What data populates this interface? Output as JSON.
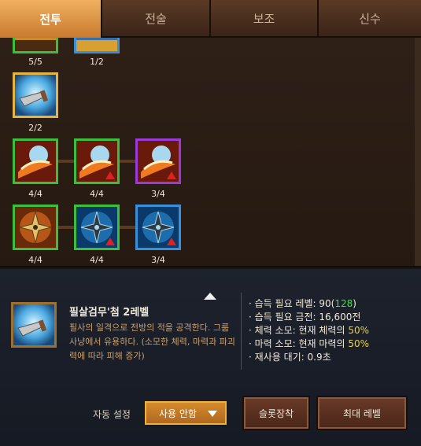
{
  "tabs": [
    {
      "label": "전투",
      "active": true
    },
    {
      "label": "전술",
      "active": false
    },
    {
      "label": "보조",
      "active": false
    },
    {
      "label": "신수",
      "active": false
    }
  ],
  "tree": {
    "slots": [
      {
        "name": "skill-top-left",
        "level": "5/5",
        "border": "green",
        "icon": "sword-icon"
      },
      {
        "name": "skill-top-mid",
        "level": "1/2",
        "border": "blue",
        "icon": "sword-icon"
      },
      {
        "name": "skill-selected",
        "level": "2/2",
        "border": "gold",
        "icon": "greatsword-icon"
      },
      {
        "name": "skill-fire-slash-1",
        "level": "4/4",
        "border": "green",
        "icon": "fire-slash-icon"
      },
      {
        "name": "skill-fire-slash-2",
        "level": "4/4",
        "border": "green",
        "icon": "fire-slash-icon"
      },
      {
        "name": "skill-fire-slash-3",
        "level": "3/4",
        "border": "purple",
        "icon": "fire-slash-icon"
      },
      {
        "name": "skill-shuriken-1",
        "level": "4/4",
        "border": "green",
        "icon": "golden-shuriken-icon"
      },
      {
        "name": "skill-shuriken-2",
        "level": "4/4",
        "border": "green",
        "icon": "blue-shuriken-icon"
      },
      {
        "name": "skill-shuriken-3",
        "level": "3/4",
        "border": "blue",
        "icon": "blue-shuriken-icon"
      }
    ]
  },
  "info": {
    "skill_name": "필살검무'첨 2레벨",
    "description": "필사의 일격으로 전방의 적을 공격한다. 그룹 사냥에서 유용하다. (소모한 체력, 마력과 파괴력에 따라 피해 증가)",
    "stats": {
      "req_level_label": "습득 필요 레벨: ",
      "req_level": "90",
      "req_level_alt": "128",
      "req_gold_label": "습득 필요 금전: ",
      "req_gold": "16,600전",
      "hp_cost_label": "체력 소모: 현재 체력의 ",
      "hp_cost": "50%",
      "mp_cost_label": "마력 소모: 현재 마력의 ",
      "mp_cost": "50%",
      "cooldown_label": "재사용 대기: ",
      "cooldown": "0.9초"
    }
  },
  "controls": {
    "auto_label": "자동 설정",
    "auto_value": "사용 안함",
    "slot_button": "슬롯장착",
    "max_button": "최대 레벨"
  }
}
